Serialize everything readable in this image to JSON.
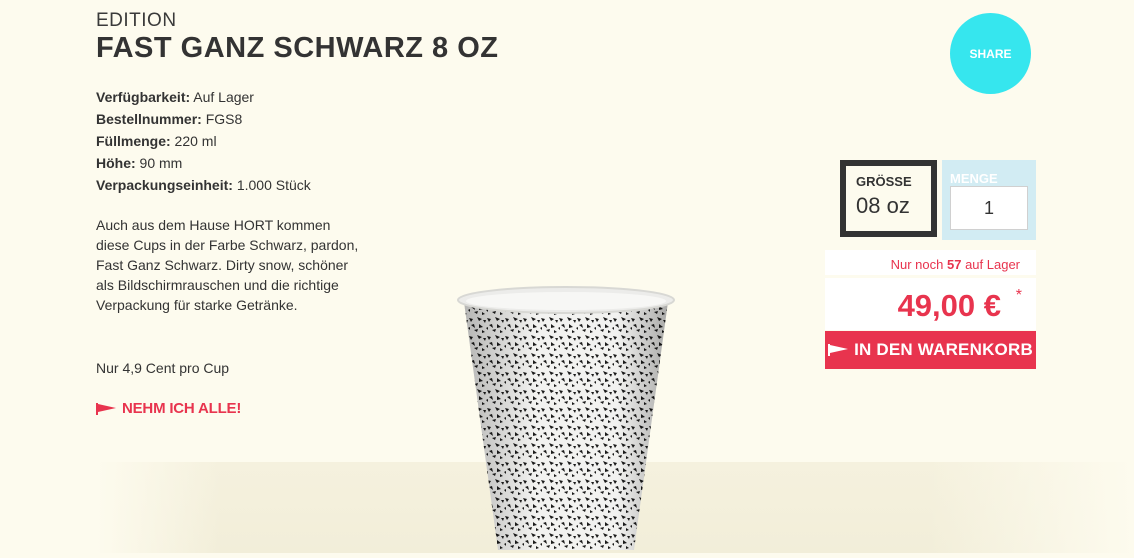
{
  "header": {
    "eyebrow": "EDITION",
    "title": "FAST GANZ SCHWARZ 8 OZ",
    "share_label": "SHARE"
  },
  "specs": [
    {
      "label": "Verfügbarkeit:",
      "value": " Auf Lager"
    },
    {
      "label": "Bestellnummer:",
      "value": " FGS8"
    },
    {
      "label": "Füllmenge:",
      "value": " 220 ml"
    },
    {
      "label": "Höhe:",
      "value": " 90 mm"
    },
    {
      "label": "Verpackungseinheit:",
      "value": " 1.000 Stück"
    }
  ],
  "description": "Auch aus dem Hause HORT kommen diese Cups in der Farbe Schwarz, pardon, Fast Ganz Schwarz. Dirty snow, schöner als Bildschirmrauschen und die richtige Verpackung für starke Getränke.",
  "note": "Nur 4,9 Cent pro Cup",
  "cta_link": "NEHM ICH ALLE!",
  "purchase": {
    "size_label": "GRÖSSE",
    "size_value": "08 oz",
    "qty_label": "MENGE",
    "qty_value": "1",
    "stock_prefix": "Nur noch ",
    "stock_count": "57",
    "stock_suffix": " auf Lager",
    "price": "49,00 €",
    "asterisk": "*",
    "cart_label": "IN DEN WARENKORB"
  },
  "colors": {
    "background": "#fdfbee",
    "accent_red": "#e8344e",
    "share_cyan": "#36e6ee",
    "qty_blue": "#d2ecf3"
  },
  "icons": {
    "flag": "pennant-flag-icon",
    "product": "paper-cup-image"
  }
}
